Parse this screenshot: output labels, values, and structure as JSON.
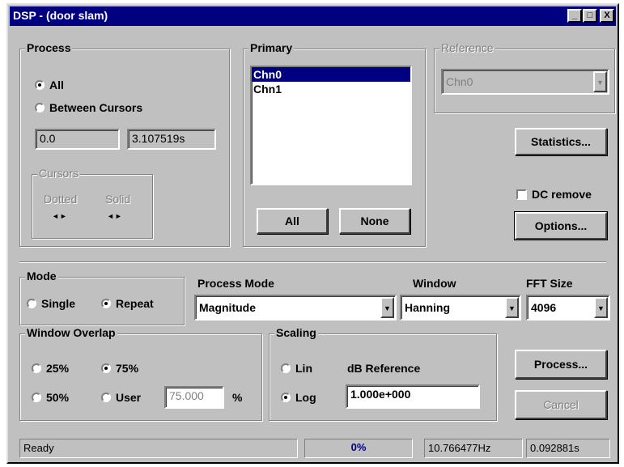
{
  "window": {
    "title": "DSP - (door slam)",
    "minimize": "_",
    "maximize": "□",
    "close": "X"
  },
  "process": {
    "legend": "Process",
    "all_label": "All",
    "between_label": "Between Cursors",
    "selected": "all",
    "start_value": "0.0",
    "end_value": "3.107519s",
    "cursors": {
      "legend": "Cursors",
      "dotted_label": "Dotted",
      "solid_label": "Solid",
      "left_arrow": "◄",
      "right_arrow": "►"
    }
  },
  "primary": {
    "legend": "Primary",
    "channels": [
      "Chn0",
      "Chn1"
    ],
    "selected_index": 0,
    "all_button": "All",
    "none_button": "None"
  },
  "reference": {
    "legend": "Reference",
    "value": "Chn0"
  },
  "statistics_button": "Statistics...",
  "dc_remove_label": "DC remove",
  "options_button": "Options...",
  "mode": {
    "legend": "Mode",
    "single_label": "Single",
    "repeat_label": "Repeat",
    "selected": "repeat"
  },
  "process_mode": {
    "label": "Process Mode",
    "value": "Magnitude"
  },
  "window_select": {
    "label": "Window",
    "value": "Hanning"
  },
  "fft_size": {
    "label": "FFT Size",
    "value": "4096"
  },
  "overlap": {
    "legend": "Window Overlap",
    "opt25": "25%",
    "opt75": "75%",
    "opt50": "50%",
    "user_label": "User",
    "user_value": "75.000",
    "unit": "%",
    "selected": "75%"
  },
  "scaling": {
    "legend": "Scaling",
    "lin_label": "Lin",
    "log_label": "Log",
    "selected": "log",
    "db_ref_label": "dB Reference",
    "db_ref_value": "1.000e+000"
  },
  "process_button": "Process...",
  "cancel_button": "Cancel",
  "status": {
    "text": "Ready",
    "progress": "0%",
    "progress_fraction": 0.0,
    "freq": "10.766477Hz",
    "time": "0.092881s"
  }
}
